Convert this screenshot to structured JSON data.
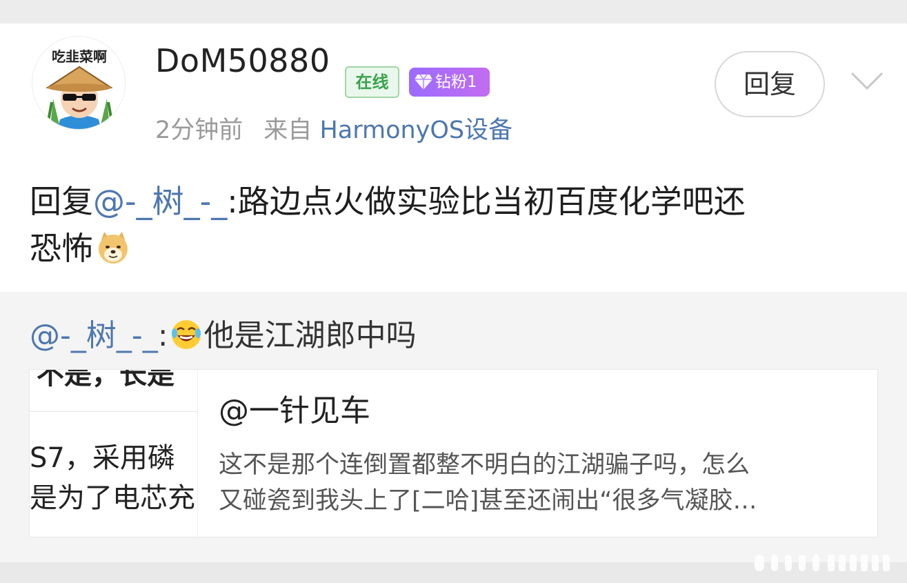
{
  "post": {
    "avatar_text": "吃韭菜啊",
    "username": "DoM50880",
    "online_badge": "在线",
    "fan_badge": "钻粉1",
    "time": "2分钟前",
    "source_prefix": "来自",
    "source_device": "HarmonyOS设备",
    "reply_button": "回复",
    "content": {
      "prefix": "回复",
      "mention": "@-_树_-_",
      "text_line1": ":路边点火做实验比当初百度化学吧还",
      "text_line2": "恐怖"
    }
  },
  "quoted": {
    "mention": "@-_树_-_",
    "separator": ":",
    "text": "他是江湖郎中吗",
    "link_card": {
      "title": "@一针见车",
      "desc_line1": "这不是那个连倒置都整不明白的江湖骗子吗，怎么",
      "desc_line2": "又碰瓷到我头上了[二哈]甚至还闹出“很多气凝胶…",
      "thumb_text1": "不是，长是",
      "thumb_text2": "S7，采用磷",
      "thumb_text3": "是为了电芯充"
    }
  },
  "colors": {
    "mention": "#4d77ae",
    "online_green": "#3aa24c",
    "fan_purple": "#9b6bff"
  },
  "icons": [
    "gem-icon",
    "chevron-down-icon",
    "doge-emoji-icon",
    "laugh-cry-emoji-icon"
  ]
}
